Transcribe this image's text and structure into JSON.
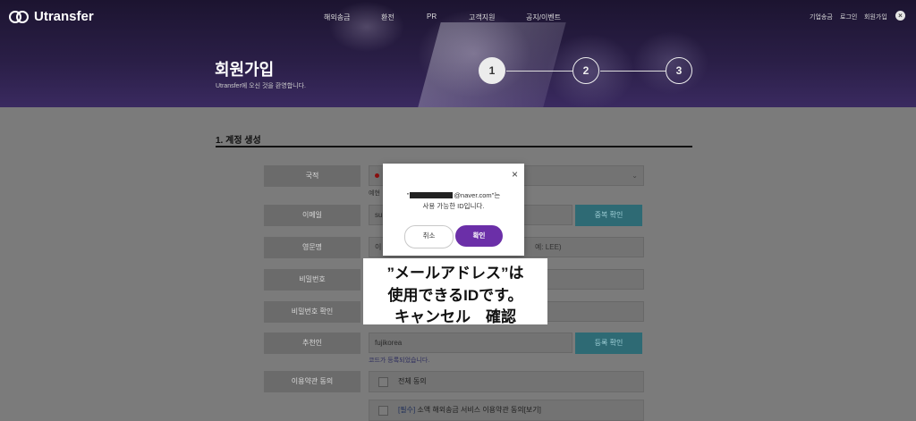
{
  "header": {
    "logo_text": "Utransfer",
    "nav": [
      "해외송금",
      "환전",
      "PR",
      "고객지원",
      "공지/이벤트"
    ],
    "util": [
      "기업송금",
      "로그인",
      "회원가입"
    ],
    "title": "회원가입",
    "subtitle": "Utransfer에 오신 것을 환영합니다.",
    "steps": [
      "1",
      "2",
      "3"
    ],
    "active_step": 1
  },
  "form": {
    "section_title": "1. 계정 생성",
    "labels": {
      "country": "국적",
      "email": "이메일",
      "english_name": "영문명",
      "password": "비밀번호",
      "password_confirm": "비밀번호 확인",
      "referrer": "추천인",
      "terms": "이용약관 동의"
    },
    "country_note": "예현",
    "email_value": "su",
    "english_name_placeholder": "이",
    "english_name_hint": "예: LEE)",
    "check_dup_button": "중복 확인",
    "referrer_value": "fujikorea",
    "code_button": "등록 확인",
    "referrer_note": "코드가 등록되었습니다.",
    "terms_all": "전체 동의",
    "terms_required_prefix": "[필수]",
    "terms_required_text": "소액 해외송금 서비스 이용약관 동의[보기]"
  },
  "dialog": {
    "message_prefix": "\"",
    "message_email": "@naver.com\"는",
    "message_line2": "사용 가능한 ID입니다.",
    "cancel_label": "취소",
    "ok_label": "확인",
    "close_symbol": "×"
  },
  "caption": {
    "line1": "”メールアドレス”は",
    "line2": "使用できるIDです。",
    "line3": "キャンセル　確認"
  },
  "colors": {
    "accent": "#6b2fa8",
    "teal_button": "#2e6a74"
  }
}
